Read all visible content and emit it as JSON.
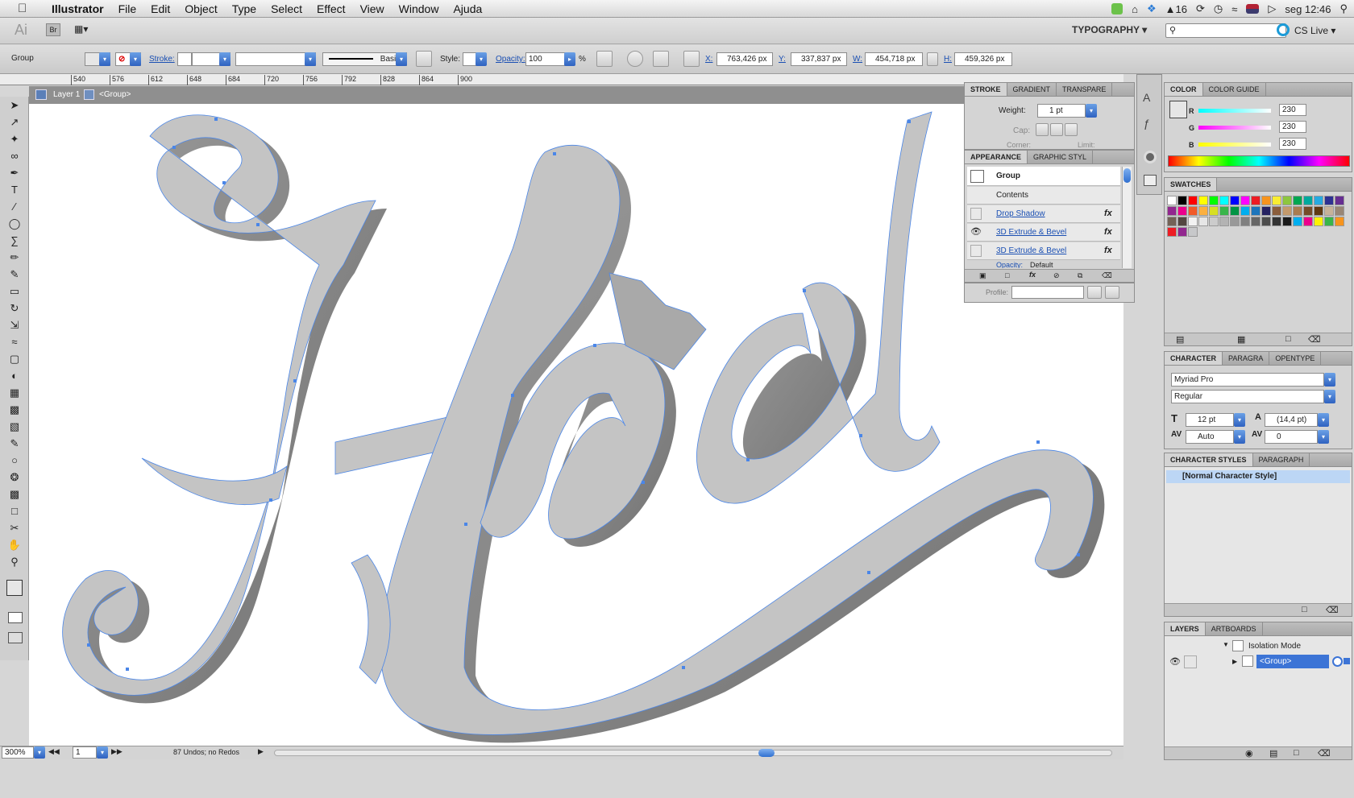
{
  "menubar": {
    "apple": "",
    "items": [
      "Illustrator",
      "File",
      "Edit",
      "Object",
      "Type",
      "Select",
      "Effect",
      "View",
      "Window",
      "Ajuda"
    ],
    "status_num": "16",
    "clock": "seg 12:46"
  },
  "appbar": {
    "ai_label": "Ai",
    "br_label": "Br",
    "workspace": "TYPOGRAPHY",
    "cs_live": "CS Live",
    "search_placeholder": ""
  },
  "control": {
    "selection": "Group",
    "stroke_label": "Stroke:",
    "brush_label": "Basic",
    "style_label": "Style:",
    "opacity_label": "Opacity:",
    "opacity_value": "100",
    "opacity_unit": "%",
    "x_label": "X:",
    "x_value": "763,426 px",
    "y_label": "Y:",
    "y_value": "337,837 px",
    "w_label": "W:",
    "w_value": "454,718 px",
    "h_label": "H:",
    "h_value": "459,326 px"
  },
  "ruler": {
    "ticks": [
      "540",
      "576",
      "612",
      "648",
      "684",
      "720",
      "756",
      "792",
      "828",
      "864",
      "900"
    ],
    "left_ticks": "540"
  },
  "isolation": {
    "layer": "Layer 1",
    "group": "<Group>"
  },
  "status": {
    "zoom": "300%",
    "page": "1",
    "message": "87 Undos; no Redos"
  },
  "stroke_panel": {
    "tabs": [
      "STROKE",
      "GRADIENT",
      "TRANSPARE"
    ],
    "weight_label": "Weight:",
    "weight_value": "1 pt",
    "cap_label": "Cap:",
    "corner_label": "Corner:",
    "limit_label": "Limit:"
  },
  "appearance": {
    "tabs": [
      "APPEARANCE",
      "GRAPHIC STYL"
    ],
    "target": "Group",
    "contents": "Contents",
    "effects": [
      "Drop Shadow",
      "3D Extrude & Bevel",
      "3D Extrude & Bevel"
    ],
    "fx": "fx",
    "opacity_label": "Opacity:",
    "opacity_value": "Default"
  },
  "profile": {
    "label": "Profile:"
  },
  "color_panel": {
    "tabs": [
      "COLOR",
      "COLOR GUIDE"
    ],
    "r_label": "R",
    "r_value": "230",
    "g_label": "G",
    "g_value": "230",
    "b_label": "B",
    "b_value": "230"
  },
  "swatches": {
    "title": "SWATCHES",
    "colors": [
      "#ffffff",
      "#000000",
      "#ff0000",
      "#ffff00",
      "#00ff00",
      "#00ffff",
      "#0000ff",
      "#ff00ff",
      "#ed1c24",
      "#f7941d",
      "#f9ed32",
      "#8dc63f",
      "#00a651",
      "#00a99d",
      "#27aae1",
      "#2e3192",
      "#662d91",
      "#92278f",
      "#ec008c",
      "#f15a29",
      "#fbb040",
      "#d7df23",
      "#39b54a",
      "#009444",
      "#00aeef",
      "#1c75bc",
      "#262262",
      "#8b5e3c",
      "#c49a6c",
      "#a97c50",
      "#754c29",
      "#603913",
      "#c7b299",
      "#998675",
      "#736357",
      "#534741",
      "#f2f2f2",
      "#e6e6e6",
      "#cccccc",
      "#b3b3b3",
      "#999999",
      "#808080",
      "#666666",
      "#4d4d4d",
      "#333333",
      "#1a1a1a",
      "#00aeef",
      "#ec008c",
      "#fff200",
      "#39b54a",
      "#f7941d",
      "#ed1c24",
      "#92278f",
      "#c7c8ca"
    ]
  },
  "character": {
    "tabs": [
      "CHARACTER",
      "PARAGRA",
      "OPENTYPE"
    ],
    "font": "Myriad Pro",
    "style": "Regular",
    "size": "12 pt",
    "leading": "(14,4 pt)",
    "kerning": "Auto",
    "tracking": "0"
  },
  "char_styles": {
    "tabs": [
      "CHARACTER STYLES",
      "PARAGRAPH"
    ],
    "item": "[Normal Character Style]"
  },
  "layers": {
    "tabs": [
      "LAYERS",
      "ARTBOARDS"
    ],
    "items": [
      "Isolation Mode",
      "<Group>"
    ]
  },
  "artwork": {
    "letters": [
      "H",
      "e",
      "d"
    ]
  }
}
